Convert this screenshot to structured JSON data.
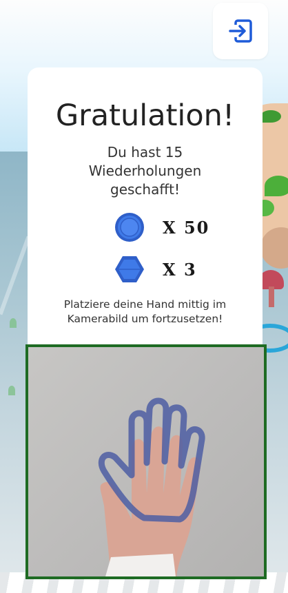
{
  "game": {
    "exit_icon": "exit-icon",
    "accent_color": "#1e5bd8",
    "dialog": {
      "title": "Gratulation!",
      "message_lines": [
        "Du hast 15",
        "Wiederholungen",
        "geschafft!"
      ],
      "rewards": [
        {
          "icon": "coin-icon",
          "label": "X 50"
        },
        {
          "icon": "gem-icon",
          "label": "X 3"
        }
      ],
      "instruction_lines": [
        "Platziere deine Hand mittig im",
        "Kamerabild um fortzusetzen!"
      ]
    },
    "camera": {
      "overlay_icon": "hand-outline-icon",
      "frame_color": "#1e6b23"
    }
  }
}
